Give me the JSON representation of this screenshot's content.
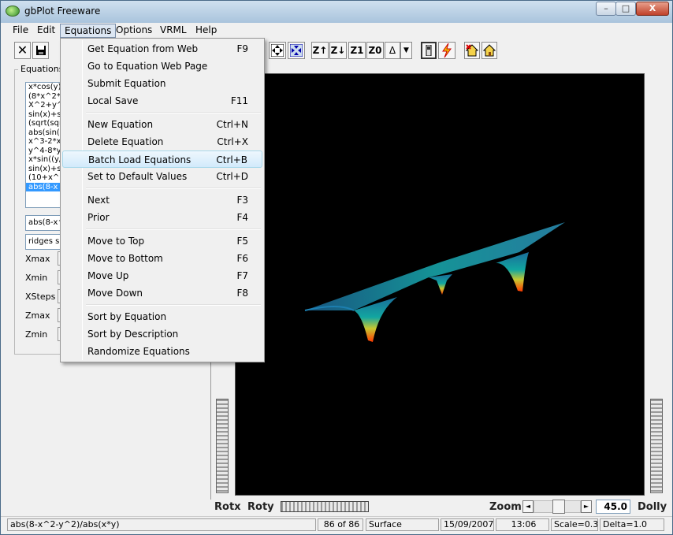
{
  "window": {
    "title": "gbPlot Freeware",
    "min_label": "–",
    "max_label": "□",
    "close_label": "X"
  },
  "menubar": [
    "File",
    "Edit",
    "Equations",
    "Options",
    "VRML",
    "Help"
  ],
  "toolbar": {
    "z_up": "Z↑",
    "z_down": "Z↓",
    "z1": "Z1",
    "z0": "Z0",
    "delta": "Δ"
  },
  "left_panel": {
    "group_label": "Equations",
    "equations": [
      "x*cos(y)",
      "(8*x^2*y",
      "X^2+y^2",
      "sin(x)+si",
      "(sqrt(sqr",
      "abs(sin(",
      "x^3-2*x",
      "y^4-8*y",
      "x*sin((y/",
      "sin(x)+si",
      "(10+x^2",
      "abs(8-x"
    ],
    "selected_index": 11,
    "edit1": "abs(8-x^2",
    "edit2": "ridges sl",
    "labels": [
      "Xmax",
      "Xmin",
      "XSteps",
      "Zmax",
      "Zmin"
    ]
  },
  "equations_menu": [
    {
      "label": "Get Equation from Web",
      "shortcut": "F9"
    },
    {
      "label": "Go to Equation Web Page",
      "shortcut": ""
    },
    {
      "label": "Submit Equation",
      "shortcut": ""
    },
    {
      "label": "Local Save",
      "shortcut": "F11"
    },
    {
      "label": "New Equation",
      "shortcut": "Ctrl+N"
    },
    {
      "label": "Delete Equation",
      "shortcut": "Ctrl+X"
    },
    {
      "label": "Batch Load Equations",
      "shortcut": "Ctrl+B"
    },
    {
      "label": "Set to Default Values",
      "shortcut": "Ctrl+D"
    },
    {
      "label": "Next",
      "shortcut": "F3"
    },
    {
      "label": "Prior",
      "shortcut": "F4"
    },
    {
      "label": "Move to Top",
      "shortcut": "F5"
    },
    {
      "label": "Move to Bottom",
      "shortcut": "F6"
    },
    {
      "label": "Move Up",
      "shortcut": "F7"
    },
    {
      "label": "Move Down",
      "shortcut": "F8"
    },
    {
      "label": "Sort by Equation",
      "shortcut": ""
    },
    {
      "label": "Sort by Description",
      "shortcut": ""
    },
    {
      "label": "Randomize Equations",
      "shortcut": ""
    }
  ],
  "highlighted_menu_item": "Batch Load Equations",
  "bottom_controls": {
    "rotx": "Rotx",
    "roty": "Roty",
    "zoom": "Zoom",
    "zoom_value": "45.0",
    "dolly": "Dolly"
  },
  "status": {
    "equation": "abs(8-x^2-y^2)/abs(x*y)",
    "count": "86 of 86",
    "mode": "Surface",
    "date": "15/09/2007",
    "time": "13:06",
    "scale": "Scale=0.3",
    "delta": "Delta=1.0"
  }
}
